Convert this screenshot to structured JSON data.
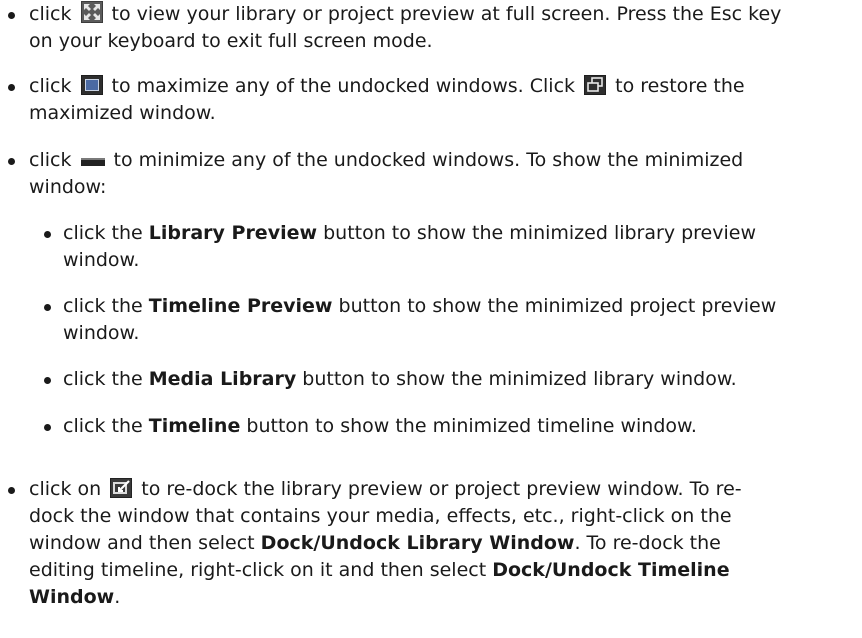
{
  "items": [
    {
      "pre": "click",
      "icon": "fullscreen-icon",
      "post": "to view your library or project preview at full screen. Press the Esc key",
      "line2": "on your keyboard to exit full screen mode."
    },
    {
      "pre": "click",
      "icon": "maximize-icon",
      "mid": "to maximize any of the undocked windows. Click",
      "icon2": "restore-icon",
      "post": "to restore the",
      "line2": "maximized window."
    },
    {
      "pre": "click",
      "icon": "minimize-icon",
      "post": "to minimize any of the undocked windows. To show the minimized",
      "line2": "window:"
    },
    {
      "pre": "click the",
      "bold": "Library Preview",
      "post": "button to show the minimized library preview",
      "line2": "window."
    },
    {
      "pre": "click the",
      "bold": "Timeline Preview",
      "post": "button to show the minimized project preview",
      "line2": "window."
    },
    {
      "pre": "click the",
      "bold": "Media Library",
      "post": "button to show the minimized library window."
    },
    {
      "pre": "click the",
      "bold": "Timeline",
      "post": "button to show the minimized timeline window."
    },
    {
      "pre": "click on",
      "icon": "redock-icon",
      "post": "to re-dock the library preview or project preview window. To re-",
      "line2": "dock the window that contains your media, effects, etc., right-click on the",
      "line3_pre": "window and then select",
      "line3_bold": "Dock/Undock Library Window",
      "line3_post": ". To re-dock the",
      "line4_pre": "editing timeline, right-click on it and then select",
      "line4_bold": "Dock/Undock Timeline",
      "line5_bold": "Window",
      "line5_post": "."
    }
  ]
}
